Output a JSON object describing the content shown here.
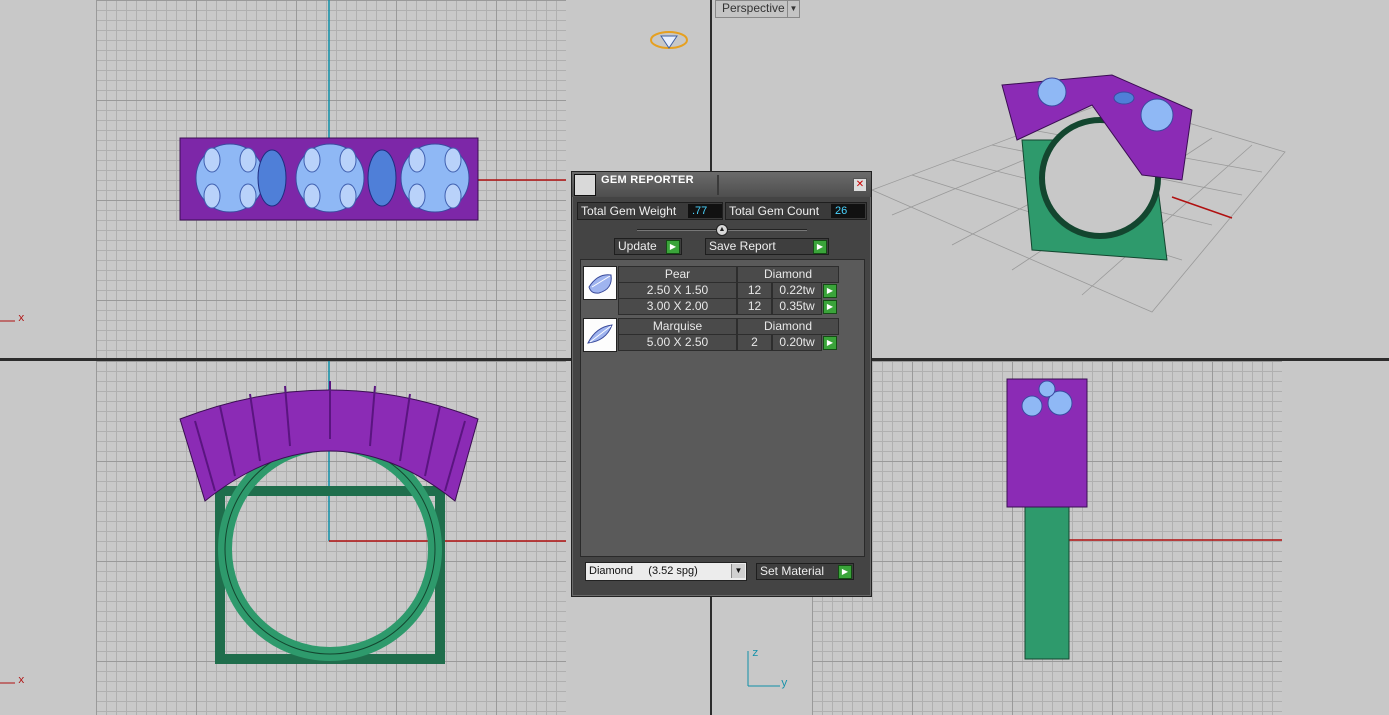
{
  "viewports": {
    "perspective_label": "Perspective",
    "top_axis_x": "x",
    "front_axis_x": "x",
    "right_axis_z": "z",
    "right_axis_y": "y"
  },
  "gem_reporter": {
    "title": "GEM REPORTER",
    "total_weight_label": "Total Gem Weight",
    "total_weight_value": ".77",
    "total_count_label": "Total Gem Count",
    "total_count_value": "26",
    "update_label": "Update",
    "save_report_label": "Save Report",
    "groups": [
      {
        "shape": "Pear",
        "material": "Diamond",
        "rows": [
          {
            "size": "2.50 X 1.50",
            "count": "12",
            "weight": "0.22tw"
          },
          {
            "size": "3.00 X 2.00",
            "count": "12",
            "weight": "0.35tw"
          }
        ]
      },
      {
        "shape": "Marquise",
        "material": "Diamond",
        "rows": [
          {
            "size": "5.00 X 2.50",
            "count": "2",
            "weight": "0.20tw"
          }
        ]
      }
    ],
    "material_select": "Diamond     (3.52 spg)",
    "set_material_label": "Set Material"
  },
  "colors": {
    "prongs": "#8b2bb5",
    "gems": "#7aa8f0",
    "shank": "#2e9a6c",
    "axis_x": "#b01010",
    "axis_y": "#1090a8",
    "go_button": "#3aa43a"
  }
}
